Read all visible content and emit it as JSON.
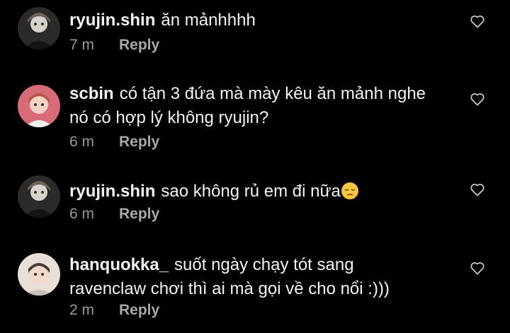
{
  "comments": [
    {
      "username": "ryujin.shin",
      "text": "ăn mảnhhhh",
      "time": "7 m",
      "reply_label": "Reply",
      "avatar_icon": "avatar-ryujin"
    },
    {
      "username": "scbin",
      "text": "có tận 3 đứa mà mày kêu ăn mảnh nghe nó có hợp lý không ryujin?",
      "time": "6 m",
      "reply_label": "Reply",
      "avatar_icon": "avatar-scbin"
    },
    {
      "username": "ryujin.shin",
      "text": "sao không rủ em đi nữa",
      "emoji": "pensive-face-emoji",
      "time": "6 m",
      "reply_label": "Reply",
      "avatar_icon": "avatar-ryujin"
    },
    {
      "username": "hanquokka_",
      "text": "suốt ngày chạy tót sang ravenclaw chơi thì ai mà gọi về cho nổi :)))",
      "time": "2 m",
      "reply_label": "Reply",
      "avatar_icon": "avatar-hanquokka"
    }
  ],
  "colors": {
    "background": "#000000",
    "text": "#f2f2f2",
    "meta": "#9a9a9a"
  },
  "icons": {
    "like": "heart-outline-icon"
  }
}
